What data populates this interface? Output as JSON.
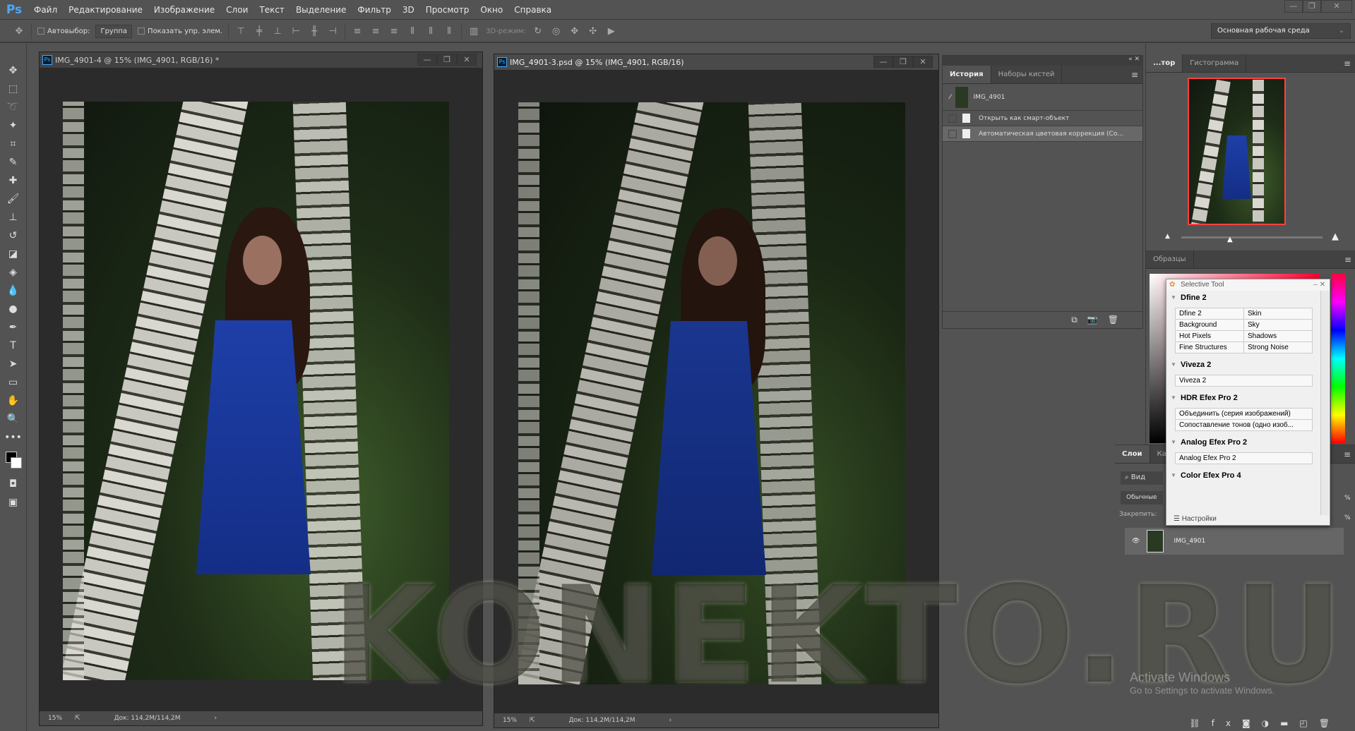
{
  "app": {
    "logo": "Ps"
  },
  "menu": [
    "Файл",
    "Редактирование",
    "Изображение",
    "Слои",
    "Текст",
    "Выделение",
    "Фильтр",
    "3D",
    "Просмотр",
    "Окно",
    "Справка"
  ],
  "window_controls": {
    "minimize": "—",
    "restore": "❐",
    "close": "✕"
  },
  "options": {
    "autoselect": "Автовыбор:",
    "group": "Группа",
    "show_controls": "Показать упр. элем.",
    "mode_3d": "3D-режим:",
    "workspace": "Основная рабочая среда"
  },
  "documents": [
    {
      "title": "IMG_4901-4 @ 15% (IMG_4901, RGB/16) *",
      "zoom": "15%",
      "doc": "Док: 114,2M/114,2M"
    },
    {
      "title": "IMG_4901-3.psd @ 15% (IMG_4901, RGB/16)",
      "zoom": "15%",
      "doc": "Док: 114,2M/114,2M"
    }
  ],
  "history": {
    "tabs": [
      "История",
      "Наборы кистей"
    ],
    "snapshot": "IMG_4901",
    "items": [
      "Открыть как смарт-объект",
      "Автоматическая цветовая коррекция (Co..."
    ]
  },
  "navigator": {
    "tabs": [
      "...тор",
      "Гистограмма"
    ]
  },
  "swatches": {
    "tab": "Образцы"
  },
  "layers": {
    "tabs": [
      "Слои",
      "Кан"
    ],
    "filter": "Вид",
    "blend": "Обычные",
    "lock": "Закрепить:",
    "opacity_suffix": "%",
    "fill_suffix": "%",
    "layer_name": "IMG_4901"
  },
  "selective_tool": {
    "title": "Selective Tool",
    "sections": [
      {
        "name": "Dfine 2",
        "items": [
          "Dfine 2",
          "Skin",
          "Background",
          "Sky",
          "Hot Pixels",
          "Shadows",
          "Fine Structures",
          "Strong Noise"
        ]
      },
      {
        "name": "Viveza 2",
        "items": [
          "Viveza 2"
        ]
      },
      {
        "name": "HDR Efex Pro 2",
        "items": [
          "Объединить (серия изображений)",
          "Сопоставление тонов (одно изоб..."
        ]
      },
      {
        "name": "Analog Efex Pro 2",
        "items": [
          "Analog Efex Pro 2"
        ]
      },
      {
        "name": "Color Efex Pro 4",
        "items": []
      }
    ],
    "settings": "Настройки"
  },
  "watermark": "KONEKTO.RU",
  "activation": {
    "title": "Activate Windows",
    "subtitle": "Go to Settings to activate Windows."
  },
  "colors": {
    "accent": "#4aa8ff",
    "nav_frame": "#ff4040",
    "dress": "#1e3fa8"
  }
}
